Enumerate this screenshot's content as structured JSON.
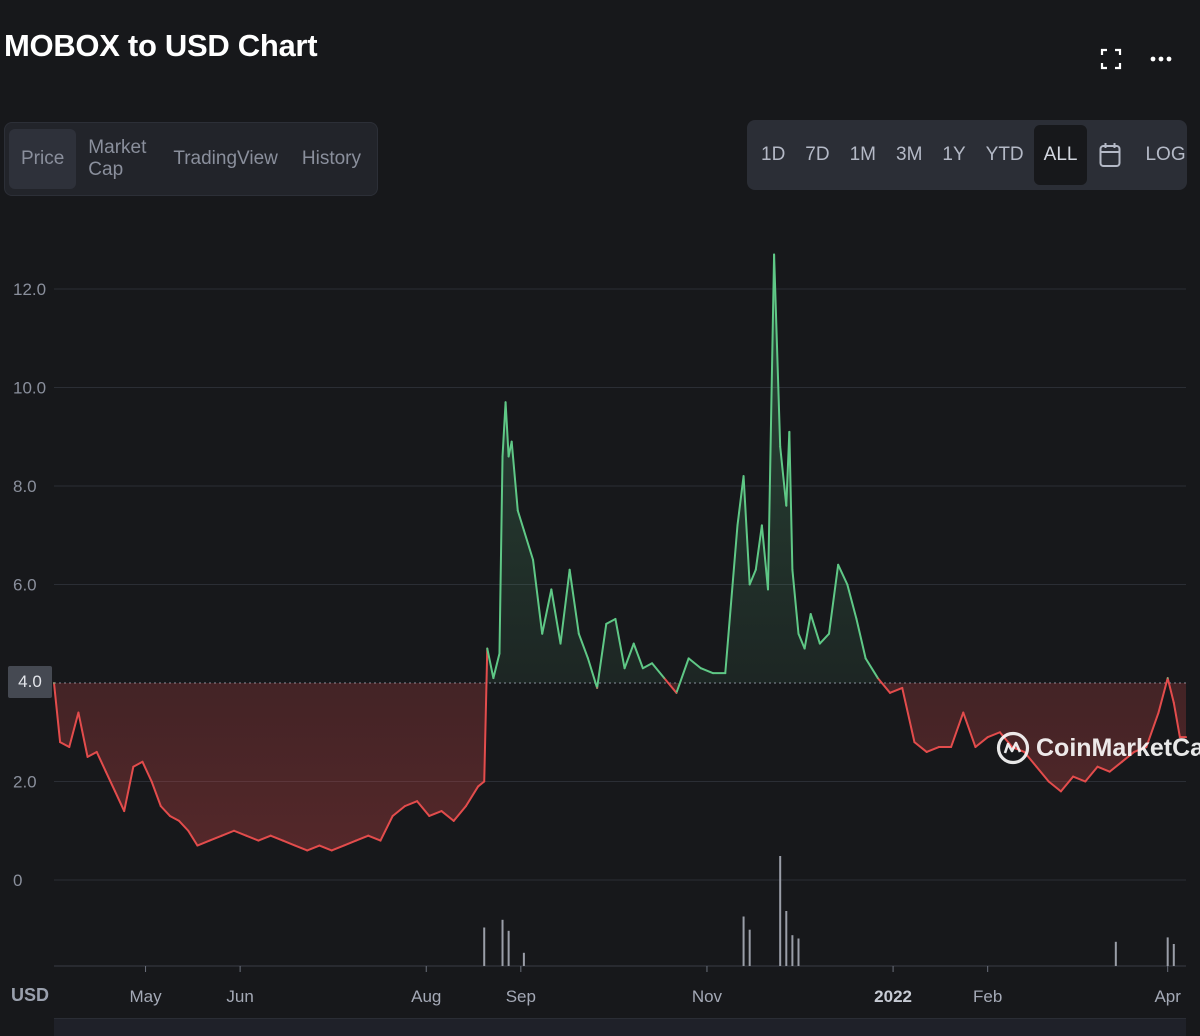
{
  "title": "MOBOX to USD Chart",
  "header": {
    "expand_icon": "expand-icon",
    "more_icon": "more-dots-icon"
  },
  "tabs": [
    {
      "label": "Price",
      "active": true
    },
    {
      "label": "Market Cap",
      "active": false
    },
    {
      "label": "TradingView",
      "active": false
    },
    {
      "label": "History",
      "active": false
    }
  ],
  "ranges": [
    {
      "label": "1D"
    },
    {
      "label": "7D"
    },
    {
      "label": "1M"
    },
    {
      "label": "3M"
    },
    {
      "label": "1Y"
    },
    {
      "label": "YTD"
    },
    {
      "label": "ALL",
      "active": true
    }
  ],
  "calendar_icon": "calendar-icon",
  "log_label": "LOG",
  "current_price_label": "4.0",
  "currency_label": "USD",
  "watermark_text": "CoinMarketCap",
  "colors": {
    "background": "#17181b",
    "up": "#5fc886",
    "down": "#e34c4c",
    "grid": "#2b2e35",
    "volume": "#9a9ea8"
  },
  "chart_data": {
    "type": "line",
    "title": "MOBOX to USD Chart",
    "ylabel": "",
    "xlabel": "",
    "ylim": [
      0,
      13
    ],
    "y_ticks": [
      0,
      2.0,
      4.0,
      6.0,
      8.0,
      10.0,
      12.0
    ],
    "y_tick_labels": [
      "0",
      "2.0",
      "4.0",
      "6.0",
      "8.0",
      "10.0",
      "12.0"
    ],
    "baseline": 4.0,
    "x_range": [
      "2021-04-01",
      "2022-04-07"
    ],
    "x_ticks": [
      {
        "label": "May",
        "date": "2021-05-01",
        "bold": false
      },
      {
        "label": "Jun",
        "date": "2021-06-01",
        "bold": false
      },
      {
        "label": "Aug",
        "date": "2021-08-01",
        "bold": false
      },
      {
        "label": "Sep",
        "date": "2021-09-01",
        "bold": false
      },
      {
        "label": "Nov",
        "date": "2021-11-01",
        "bold": false
      },
      {
        "label": "2022",
        "date": "2022-01-01",
        "bold": true
      },
      {
        "label": "Feb",
        "date": "2022-02-01",
        "bold": false
      },
      {
        "label": "Apr",
        "date": "2022-04-01",
        "bold": false
      }
    ],
    "series": [
      {
        "x": [
          "2021-04-01",
          "2021-04-03",
          "2021-04-06",
          "2021-04-09",
          "2021-04-12",
          "2021-04-15",
          "2021-04-18",
          "2021-04-21",
          "2021-04-24",
          "2021-04-27",
          "2021-04-30",
          "2021-05-03",
          "2021-05-06",
          "2021-05-09",
          "2021-05-12",
          "2021-05-15",
          "2021-05-18",
          "2021-05-22",
          "2021-05-26",
          "2021-05-30",
          "2021-06-03",
          "2021-06-07",
          "2021-06-11",
          "2021-06-15",
          "2021-06-19",
          "2021-06-23",
          "2021-06-27",
          "2021-07-01",
          "2021-07-05",
          "2021-07-09",
          "2021-07-13",
          "2021-07-17",
          "2021-07-21",
          "2021-07-25",
          "2021-07-29",
          "2021-08-02",
          "2021-08-06",
          "2021-08-10",
          "2021-08-14",
          "2021-08-18",
          "2021-08-20",
          "2021-08-21",
          "2021-08-23",
          "2021-08-25",
          "2021-08-26",
          "2021-08-27",
          "2021-08-28",
          "2021-08-29",
          "2021-08-31",
          "2021-09-02",
          "2021-09-05",
          "2021-09-08",
          "2021-09-11",
          "2021-09-14",
          "2021-09-17",
          "2021-09-20",
          "2021-09-23",
          "2021-09-26",
          "2021-09-29",
          "2021-10-02",
          "2021-10-05",
          "2021-10-08",
          "2021-10-11",
          "2021-10-14",
          "2021-10-18",
          "2021-10-22",
          "2021-10-26",
          "2021-10-30",
          "2021-11-03",
          "2021-11-07",
          "2021-11-11",
          "2021-11-13",
          "2021-11-15",
          "2021-11-17",
          "2021-11-19",
          "2021-11-21",
          "2021-11-23",
          "2021-11-25",
          "2021-11-27",
          "2021-11-28",
          "2021-11-29",
          "2021-12-01",
          "2021-12-03",
          "2021-12-05",
          "2021-12-08",
          "2021-12-11",
          "2021-12-14",
          "2021-12-17",
          "2021-12-20",
          "2021-12-23",
          "2021-12-27",
          "2021-12-31",
          "2022-01-04",
          "2022-01-08",
          "2022-01-12",
          "2022-01-16",
          "2022-01-20",
          "2022-01-24",
          "2022-01-28",
          "2022-02-01",
          "2022-02-05",
          "2022-02-09",
          "2022-02-13",
          "2022-02-17",
          "2022-02-21",
          "2022-02-25",
          "2022-03-01",
          "2022-03-05",
          "2022-03-09",
          "2022-03-13",
          "2022-03-17",
          "2022-03-21",
          "2022-03-25",
          "2022-03-29",
          "2022-04-01",
          "2022-04-03",
          "2022-04-05",
          "2022-04-07"
        ],
        "values": [
          4.0,
          2.8,
          2.7,
          3.4,
          2.5,
          2.6,
          2.2,
          1.8,
          1.4,
          2.3,
          2.4,
          2.0,
          1.5,
          1.3,
          1.2,
          1.0,
          0.7,
          0.8,
          0.9,
          1.0,
          0.9,
          0.8,
          0.9,
          0.8,
          0.7,
          0.6,
          0.7,
          0.6,
          0.7,
          0.8,
          0.9,
          0.8,
          1.3,
          1.5,
          1.6,
          1.3,
          1.4,
          1.2,
          1.5,
          1.9,
          2.0,
          4.7,
          4.1,
          4.6,
          8.6,
          9.7,
          8.6,
          8.9,
          7.5,
          7.1,
          6.5,
          5.0,
          5.9,
          4.8,
          6.3,
          5.0,
          4.5,
          3.9,
          5.2,
          5.3,
          4.3,
          4.8,
          4.3,
          4.4,
          4.1,
          3.8,
          4.5,
          4.3,
          4.2,
          4.2,
          7.2,
          8.2,
          6.0,
          6.3,
          7.2,
          5.9,
          12.7,
          8.8,
          7.6,
          9.1,
          6.3,
          5.0,
          4.7,
          5.4,
          4.8,
          5.0,
          6.4,
          6.0,
          5.3,
          4.5,
          4.1,
          3.8,
          3.9,
          2.8,
          2.6,
          2.7,
          2.7,
          3.4,
          2.7,
          2.9,
          3.0,
          2.7,
          2.6,
          2.3,
          2.0,
          1.8,
          2.1,
          2.0,
          2.3,
          2.2,
          2.4,
          2.6,
          2.7,
          3.4,
          4.1,
          3.6,
          2.9,
          2.9
        ]
      }
    ],
    "volume": {
      "x": [
        "2021-08-20",
        "2021-08-26",
        "2021-08-28",
        "2021-09-02",
        "2021-11-13",
        "2021-11-15",
        "2021-11-25",
        "2021-11-27",
        "2021-11-29",
        "2021-12-01",
        "2022-03-15",
        "2022-04-01",
        "2022-04-03"
      ],
      "values": [
        0.35,
        0.42,
        0.32,
        0.12,
        0.45,
        0.33,
        1.0,
        0.5,
        0.28,
        0.25,
        0.22,
        0.26,
        0.2
      ]
    }
  }
}
